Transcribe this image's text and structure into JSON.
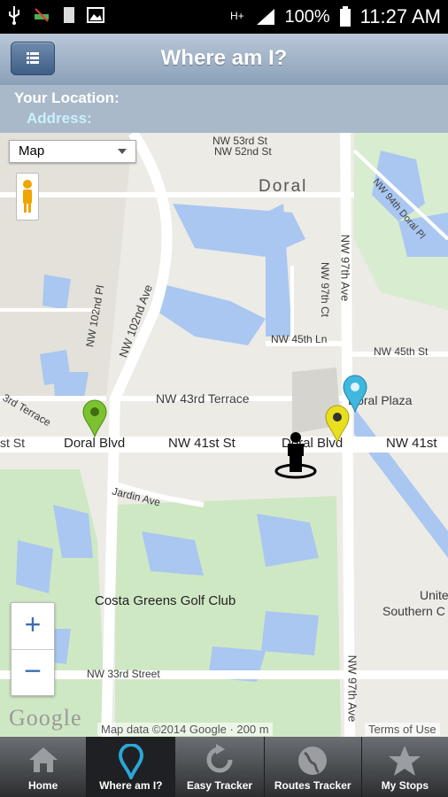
{
  "status_bar": {
    "battery": "100%",
    "time": "11:27 AM"
  },
  "header": {
    "title": "Where am I?"
  },
  "location": {
    "your_location_label": "Your Location:",
    "address_label": "Address:"
  },
  "map": {
    "map_type_selected": "Map",
    "labels": {
      "doral": "Doral",
      "doral_blvd": "Doral Blvd",
      "nw_41st_st": "NW 41st St",
      "nw_41st_right": "NW 41st",
      "st_st": "st St",
      "doral_blvd_2": "Doral Blvd",
      "doral_plaza": "Doral Plaza",
      "nw_43rd_terrace": "NW 43rd Terrace",
      "nw_45th_ln": "NW 45th Ln",
      "nw_45th_st": "NW 45th St",
      "jardin_ave": "Jardin Ave",
      "costa_greens": "Costa Greens Golf Club",
      "nw_33rd_street": "NW 33rd Street",
      "nw_102nd_ave": "NW 102nd Ave",
      "nw_97th_ave": "NW 97th Ave",
      "nw_97th_ave_south": "NW 97th Ave",
      "nw_97th_ct": "NW 97th Ct",
      "nw_102nd_pl": "NW 102nd Pl",
      "nw_94th_doral_pl": "NW 94th Doral Pl",
      "nw_52nd_st": "NW 52nd St",
      "nw_53rd_st": "NW 53rd St",
      "third_terrace": "3rd Terrace",
      "united": "Unite",
      "southern": "Southern C"
    },
    "attribution": "Map data ©2014 Google · 200 m",
    "terms": "Terms of Use",
    "google_logo": "Google"
  },
  "zoom": {
    "in": "+",
    "out": "−"
  },
  "nav": {
    "tabs": [
      {
        "label": "Home",
        "icon": "home-icon"
      },
      {
        "label": "Where am I?",
        "icon": "location-pin-icon"
      },
      {
        "label": "Easy Tracker",
        "icon": "refresh-icon"
      },
      {
        "label": "Routes Tracker",
        "icon": "globe-icon"
      },
      {
        "label": "My Stops",
        "icon": "star-icon"
      }
    ]
  },
  "colors": {
    "accent": "#2aa7d8",
    "header": "#8aa0b8",
    "water": "#a9c7f0",
    "park": "#cfe8c4"
  }
}
